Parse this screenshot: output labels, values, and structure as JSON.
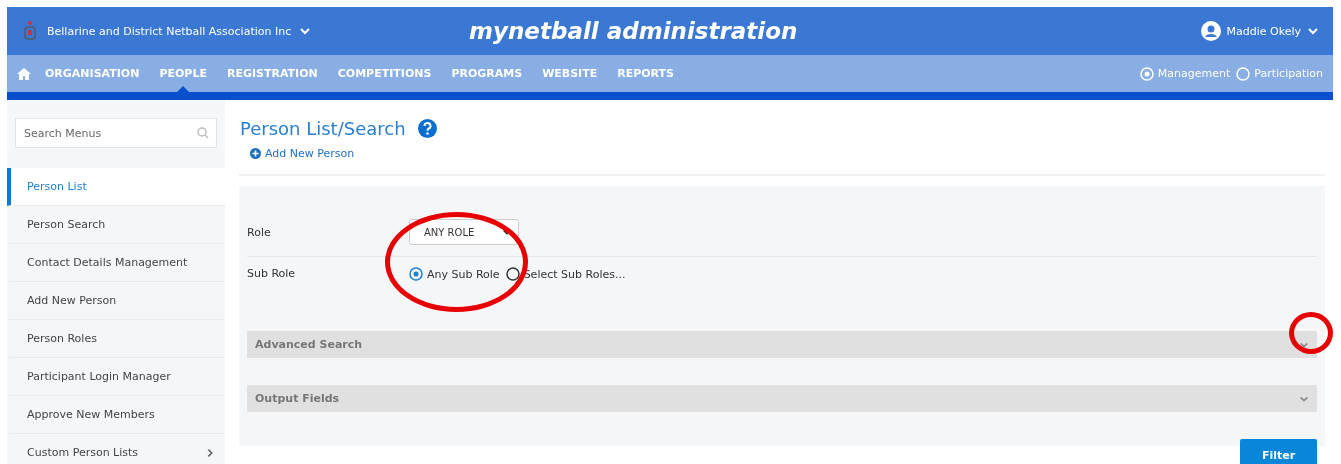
{
  "header": {
    "org_name": "Bellarine and District Netball Association Inc",
    "app_title": "mynetball administration",
    "user_name": "Maddie Okely"
  },
  "nav": {
    "items": [
      {
        "label": "ORGANISATION",
        "selected": false
      },
      {
        "label": "PEOPLE",
        "selected": true
      },
      {
        "label": "REGISTRATION",
        "selected": false
      },
      {
        "label": "COMPETITIONS",
        "selected": false
      },
      {
        "label": "PROGRAMS",
        "selected": false
      },
      {
        "label": "WEBSITE",
        "selected": false
      },
      {
        "label": "REPORTS",
        "selected": false
      }
    ],
    "modes": [
      {
        "label": "Management",
        "selected": true
      },
      {
        "label": "Participation",
        "selected": false
      }
    ]
  },
  "sidebar": {
    "search": {
      "placeholder": "Search Menus"
    },
    "items": [
      {
        "label": "Person List",
        "selected": true,
        "kind": "link"
      },
      {
        "label": "Person Search",
        "selected": false,
        "kind": "link"
      },
      {
        "label": "Contact Details Management",
        "selected": false,
        "kind": "link"
      },
      {
        "label": "Add New Person",
        "selected": false,
        "kind": "link"
      },
      {
        "label": "Person Roles",
        "selected": false,
        "kind": "link"
      },
      {
        "label": "Participant Login Manager",
        "selected": false,
        "kind": "link"
      },
      {
        "label": "Approve New Members",
        "selected": false,
        "kind": "link"
      },
      {
        "label": "Custom Person Lists",
        "selected": false,
        "kind": "submenu"
      }
    ]
  },
  "page": {
    "title": "Person List/Search",
    "add_link": "Add New Person"
  },
  "form": {
    "role": {
      "label": "Role",
      "value": "ANY ROLE"
    },
    "sub_role": {
      "label": "Sub Role",
      "options": [
        {
          "label": "Any Sub Role",
          "selected": true
        },
        {
          "label": "Select Sub Roles...",
          "selected": false
        }
      ]
    },
    "sections": [
      {
        "label": "Advanced Search",
        "expanded": false
      },
      {
        "label": "Output Fields",
        "expanded": false
      }
    ],
    "filter_button": "Filter"
  }
}
